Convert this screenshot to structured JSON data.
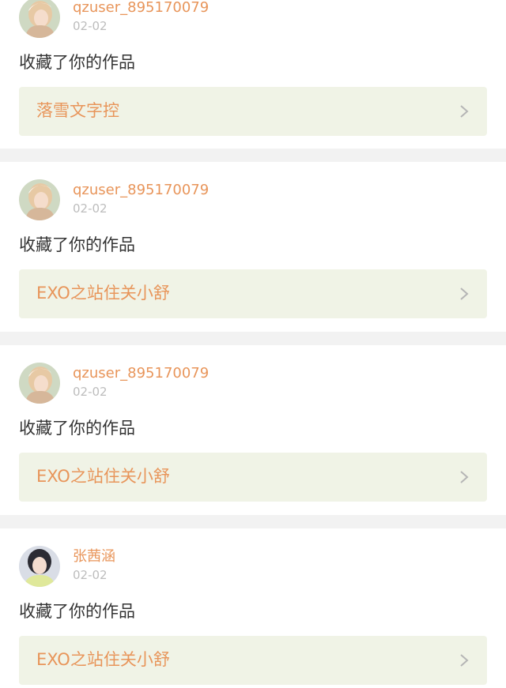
{
  "feed": {
    "items": [
      {
        "user": "qzuser_895170079",
        "date": "02-02",
        "action": "收藏了你的作品",
        "work": "落雪文字控",
        "avatar_icon": "user-avatar-blonde-woman"
      },
      {
        "user": "qzuser_895170079",
        "date": "02-02",
        "action": "收藏了你的作品",
        "work": "EXO之站住关小舒",
        "avatar_icon": "user-avatar-blonde-woman"
      },
      {
        "user": "qzuser_895170079",
        "date": "02-02",
        "action": "收藏了你的作品",
        "work": "EXO之站住关小舒",
        "avatar_icon": "user-avatar-blonde-woman"
      },
      {
        "user": "张茜涵",
        "date": "02-02",
        "action": "收藏了你的作品",
        "work": "EXO之站住关小舒",
        "avatar_icon": "user-avatar-dark-hair-woman"
      }
    ]
  },
  "colors": {
    "accent": "#e8955a",
    "work_bg": "#f0f3e6",
    "separator": "#f2f2f2",
    "date": "#bdbdbd",
    "text": "#333333"
  }
}
